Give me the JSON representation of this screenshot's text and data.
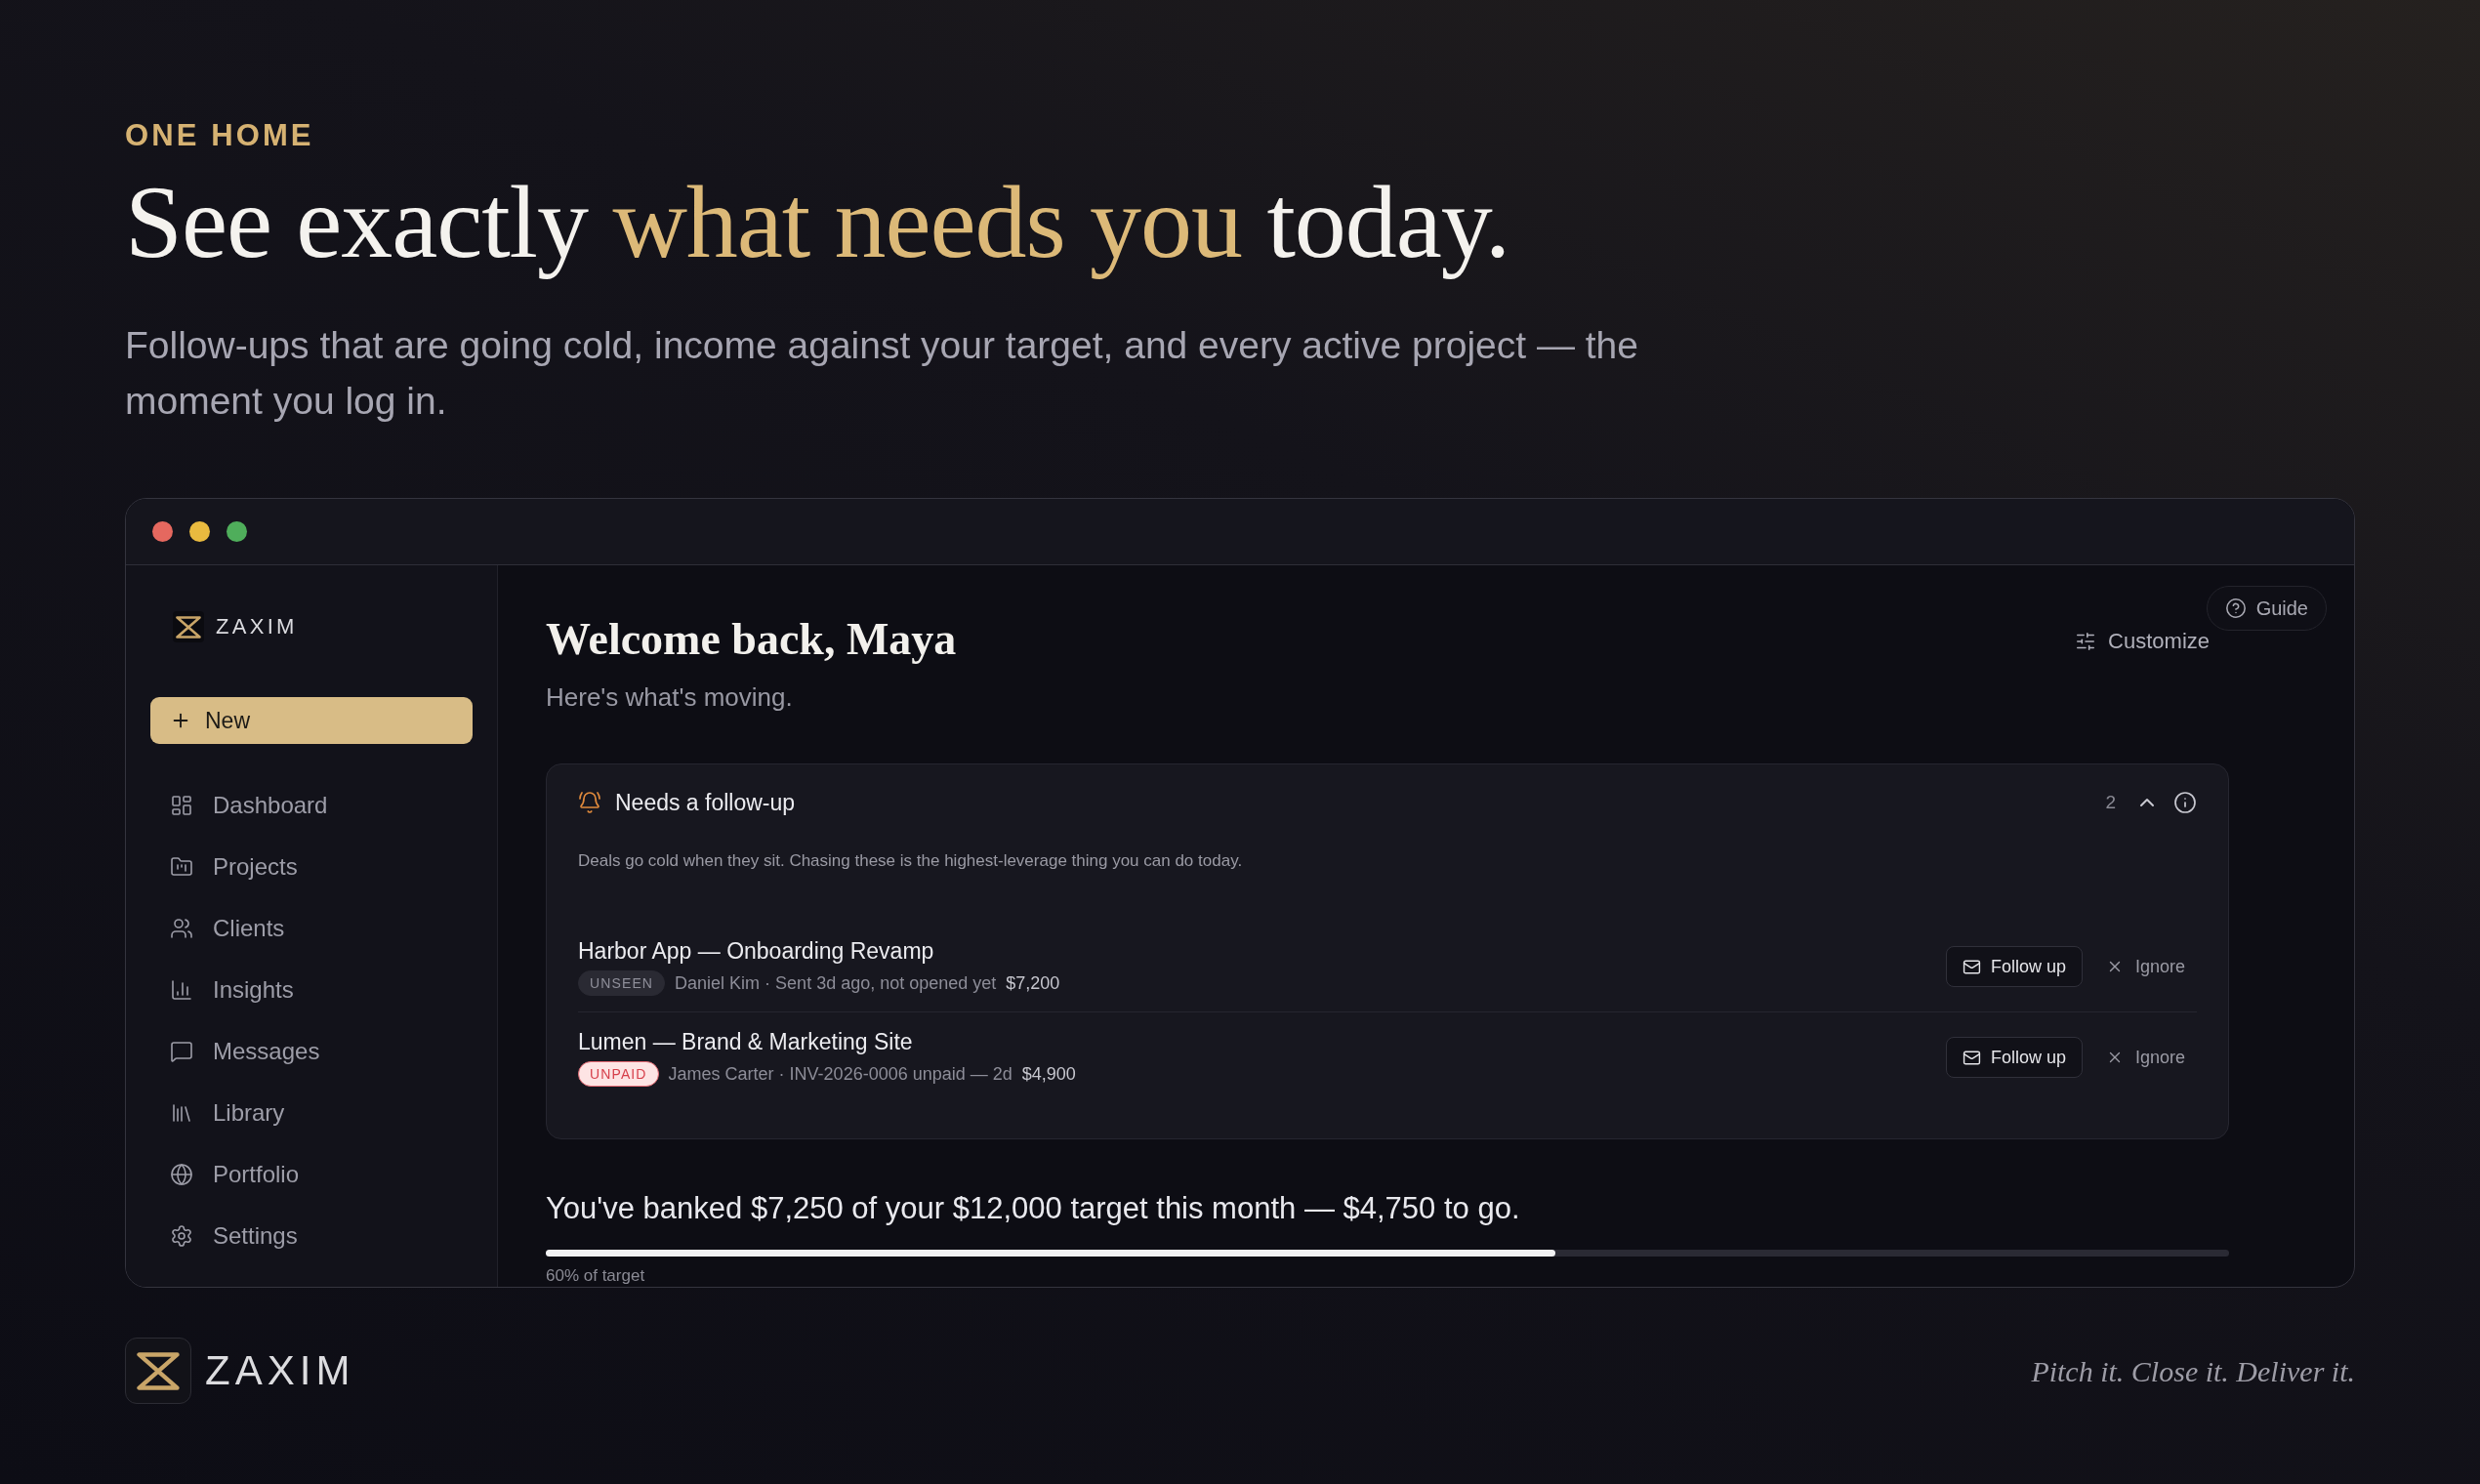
{
  "hero": {
    "eyebrow": "ONE HOME",
    "headline": [
      {
        "text": "See exactly ",
        "highlight": false
      },
      {
        "text": "what needs you",
        "highlight": true
      },
      {
        "text": " today.",
        "highlight": false
      }
    ],
    "subtitle": "Follow-ups that are going cold, income against your target, and every active project — the moment you log in."
  },
  "window": {
    "controls": [
      {
        "color": "#e5685f"
      },
      {
        "color": "#e9ba3f"
      },
      {
        "color": "#4fae5b"
      }
    ]
  },
  "sidebar": {
    "brand": "ZAXIM",
    "new_button": "New",
    "items": [
      "Dashboard",
      "Projects",
      "Clients",
      "Insights",
      "Messages",
      "Library",
      "Portfolio",
      "Settings"
    ]
  },
  "main": {
    "title": "Welcome back, Maya",
    "subtitle": "Here's what's moving.",
    "guide_button": "Guide",
    "customize_button": "Customize",
    "follow_up_card": {
      "title": "Needs a follow-up",
      "count": "2",
      "expanded": true,
      "description": "Deals go cold when they sit. Chasing these is the highest-leverage thing you can do today.",
      "items": [
        {
          "title": "Harbor App — Onboarding Revamp",
          "badge": {
            "kind": "muted",
            "label": "UNSEEN"
          },
          "meta": "Daniel Kim · Sent 3d ago, not opened yet",
          "amount": "$7,200",
          "follow_up_button": "Follow up",
          "ignore_button": "Ignore"
        },
        {
          "title": "Lumen — Brand & Marketing Site",
          "badge": {
            "kind": "alert",
            "label": "UNPAID"
          },
          "meta": "James Carter · INV-2026-0006 unpaid — 2d",
          "amount": "$4,900",
          "follow_up_button": "Follow up",
          "ignore_button": "Ignore"
        }
      ]
    },
    "income": {
      "summary": "You've banked $7,250 of your $12,000 target this month — $4,750 to go.",
      "level": 0.6,
      "caption": "60% of target"
    }
  },
  "footer": {
    "brand": "ZAXIM",
    "tagline": "Pitch it. Close it. Deliver it."
  }
}
